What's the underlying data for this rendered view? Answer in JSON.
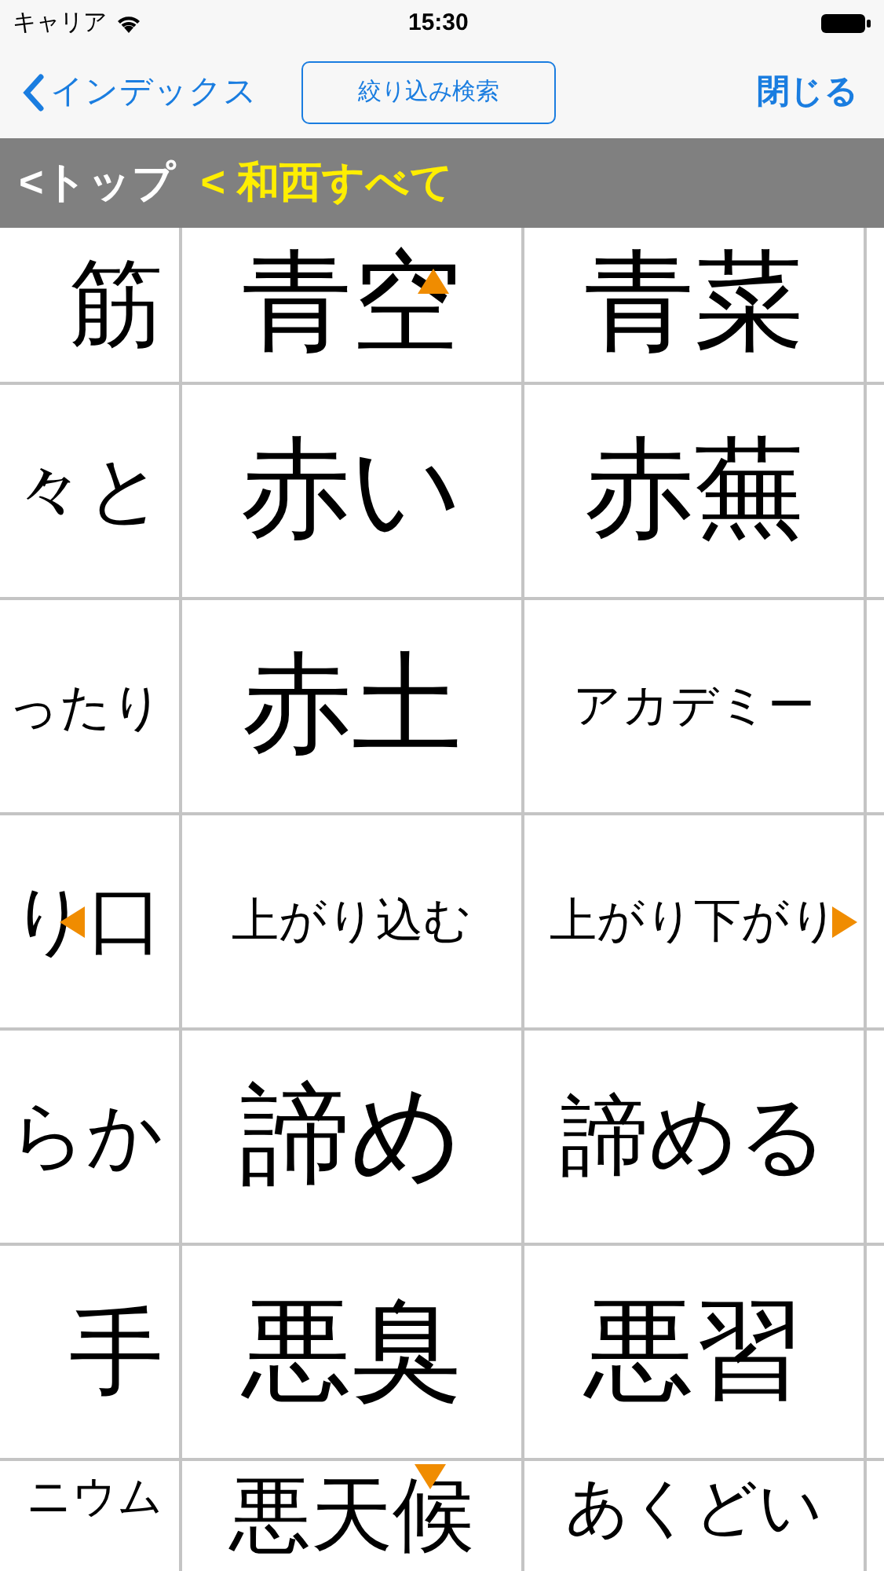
{
  "status_bar": {
    "carrier": "キャリア",
    "time": "15:30"
  },
  "nav": {
    "back": "インデックス",
    "filter_button": "絞り込み検索",
    "close": "閉じる"
  },
  "breadcrumb": [
    {
      "label": "<トップ",
      "selected": false
    },
    {
      "label": "< 和西すべて",
      "selected": true
    }
  ],
  "rows": [
    {
      "cells": [
        {
          "text": "筋",
          "kind": "plain"
        },
        {
          "text": "青空",
          "kind": "up"
        },
        {
          "text": "青菜",
          "kind": "plain"
        }
      ]
    },
    {
      "cells": [
        {
          "text": "々と",
          "kind": "plain"
        },
        {
          "text": "赤い",
          "kind": "plain"
        },
        {
          "text": "赤蕪",
          "kind": "plain"
        }
      ]
    },
    {
      "cells": [
        {
          "text": "ったり",
          "kind": "plain"
        },
        {
          "text": "赤土",
          "kind": "plain"
        },
        {
          "text": "アカデミー",
          "kind": "plain"
        }
      ]
    },
    {
      "cells": [
        {
          "text": "り口",
          "kind": "left"
        },
        {
          "text": "上がり込む",
          "kind": "plain"
        },
        {
          "text": "上がり下がり",
          "kind": "right"
        }
      ]
    },
    {
      "cells": [
        {
          "text": "らか",
          "kind": "plain"
        },
        {
          "text": "諦め",
          "kind": "plain"
        },
        {
          "text": "諦める",
          "kind": "plain"
        }
      ]
    },
    {
      "cells": [
        {
          "text": "手",
          "kind": "plain"
        },
        {
          "text": "悪臭",
          "kind": "plain"
        },
        {
          "text": "悪習",
          "kind": "plain"
        }
      ]
    },
    {
      "cells": [
        {
          "text": "ニウム",
          "kind": "plain"
        },
        {
          "text": "悪天候",
          "kind": "down"
        },
        {
          "text": "あくどい",
          "kind": "plain"
        }
      ]
    }
  ]
}
